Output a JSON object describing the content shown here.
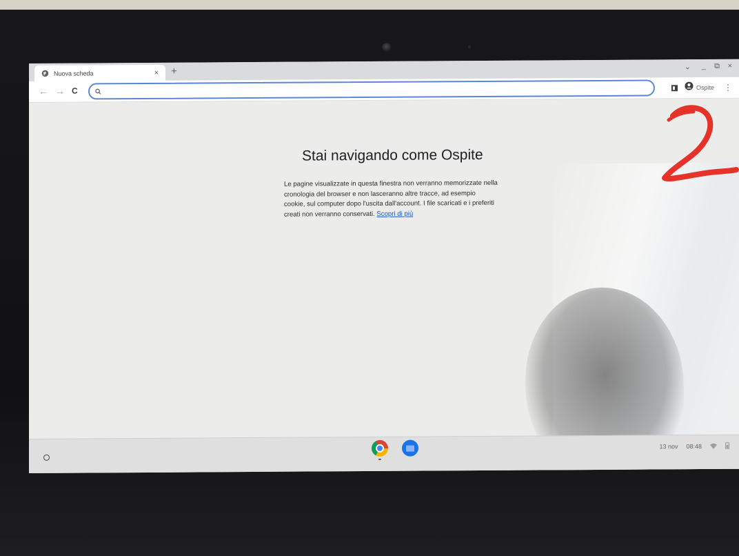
{
  "browser": {
    "tab": {
      "title": "Nuova scheda",
      "close_glyph": "×",
      "favicon": "globe-icon"
    },
    "new_tab_glyph": "+",
    "window_controls": {
      "dropdown": "⌄",
      "minimize": "_",
      "restore": "⧉",
      "close": "×"
    },
    "toolbar": {
      "back_glyph": "←",
      "forward_glyph": "→",
      "reload_glyph": "C",
      "omnibox_value": "",
      "profile_label": "Ospite",
      "menu_glyph": "⋮"
    }
  },
  "page": {
    "heading": "Stai navigando come Ospite",
    "body": "Le pagine visualizzate in questa finestra non verranno memorizzate nella cronologia del browser e non lasceranno altre tracce, ad esempio cookie, sul computer dopo l'uscita dall'account. I file scaricati e i preferiti creati non verranno conservati.",
    "link": "Scopri di più"
  },
  "shelf": {
    "apps": [
      "chrome-icon",
      "files-icon"
    ],
    "date": "13 nov",
    "time": "08:48"
  },
  "annotation": {
    "text": "2",
    "color": "#e5332a"
  }
}
